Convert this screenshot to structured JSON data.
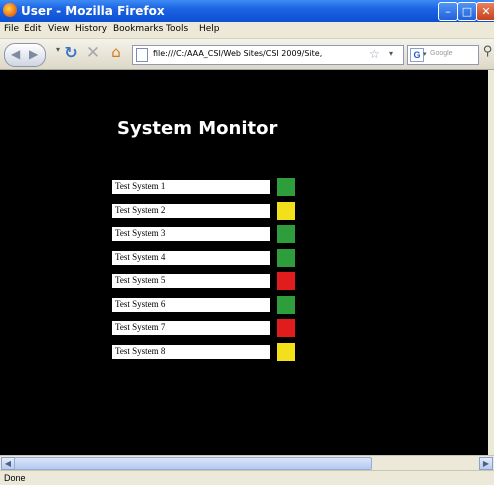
{
  "window": {
    "title": "User - Mozilla Firefox"
  },
  "menu": [
    "File",
    "Edit",
    "View",
    "History",
    "Bookmarks",
    "Tools",
    "Help"
  ],
  "nav": {
    "url": "file:///C:/AAA_CSI/Web Sites/CSI 2009/Site,",
    "search_placeholder": "Google"
  },
  "page": {
    "heading": "System Monitor",
    "systems": [
      {
        "name": "Test System 1",
        "status": "green"
      },
      {
        "name": "Test System 2",
        "status": "yellow"
      },
      {
        "name": "Test System 3",
        "status": "green"
      },
      {
        "name": "Test System 4",
        "status": "green"
      },
      {
        "name": "Test System 5",
        "status": "red"
      },
      {
        "name": "Test System 6",
        "status": "green"
      },
      {
        "name": "Test System 7",
        "status": "red"
      },
      {
        "name": "Test System 8",
        "status": "yellow"
      }
    ]
  },
  "colors": {
    "green": "#2e9e3c",
    "yellow": "#f2e11a",
    "red": "#e01c1c"
  },
  "status": "Done"
}
